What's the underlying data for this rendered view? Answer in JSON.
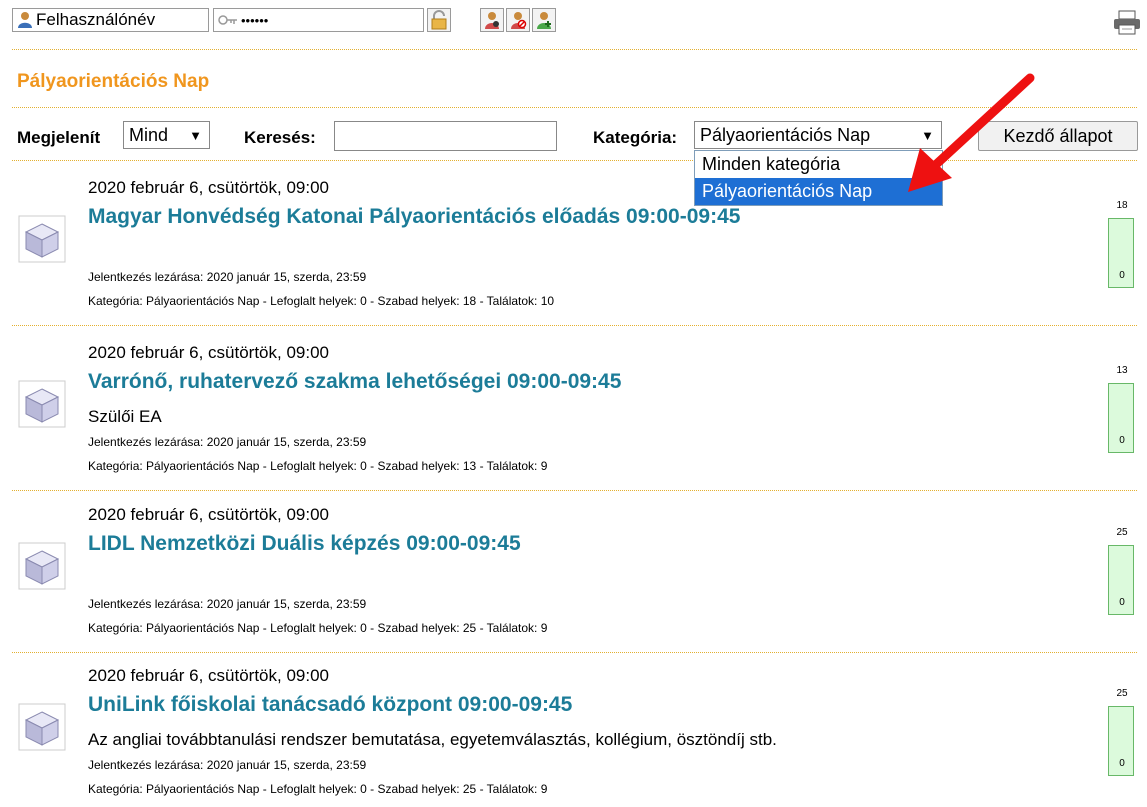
{
  "login": {
    "username_placeholder": "Felhasználónév",
    "password_value": "••••••"
  },
  "page_title": "Pályaorientációs Nap",
  "filters": {
    "display_label": "Megjelenít",
    "display_value": "Mind",
    "search_label": "Keresés:",
    "search_value": "",
    "category_label": "Kategória:",
    "category_value": "Pályaorientációs Nap",
    "reset_button": "Kezdő állapot",
    "category_options": [
      "Minden kategória",
      "Pályaorientációs Nap"
    ]
  },
  "events": [
    {
      "date": "2020 február 6, csütörtök, 09:00",
      "title": "Magyar Honvédség Katonai Pályaorientációs előadás 09:00-09:45",
      "description": "",
      "deadline": "Jelentkezés lezárása: 2020 január 15, szerda, 23:59",
      "info": "Kategória: Pályaorientációs Nap - Lefoglalt helyek: 0 - Szabad helyek: 18 - Találatok: 10",
      "meter_max": "18",
      "meter_min": "0"
    },
    {
      "date": "2020 február 6, csütörtök, 09:00",
      "title": "Varrónő, ruhatervező szakma lehetőségei 09:00-09:45",
      "description": "Szülői EA",
      "deadline": "Jelentkezés lezárása: 2020 január 15, szerda, 23:59",
      "info": "Kategória: Pályaorientációs Nap - Lefoglalt helyek: 0 - Szabad helyek: 13 - Találatok: 9",
      "meter_max": "13",
      "meter_min": "0"
    },
    {
      "date": "2020 február 6, csütörtök, 09:00",
      "title": "LIDL Nemzetközi Duális képzés 09:00-09:45",
      "description": "",
      "deadline": "Jelentkezés lezárása: 2020 január 15, szerda, 23:59",
      "info": "Kategória: Pályaorientációs Nap - Lefoglalt helyek: 0 - Szabad helyek: 25 - Találatok: 9",
      "meter_max": "25",
      "meter_min": "0"
    },
    {
      "date": "2020 február 6, csütörtök, 09:00",
      "title": "UniLink főiskolai tanácsadó központ 09:00-09:45",
      "description": "Az angliai továbbtanulási rendszer bemutatása, egyetemválasztás, kollégium, ösztöndíj stb.",
      "deadline": "Jelentkezés lezárása: 2020 január 15, szerda, 23:59",
      "info": "Kategória: Pályaorientációs Nap - Lefoglalt helyek: 0 - Szabad helyek: 25 - Találatok: 9",
      "meter_max": "25",
      "meter_min": "0"
    }
  ]
}
